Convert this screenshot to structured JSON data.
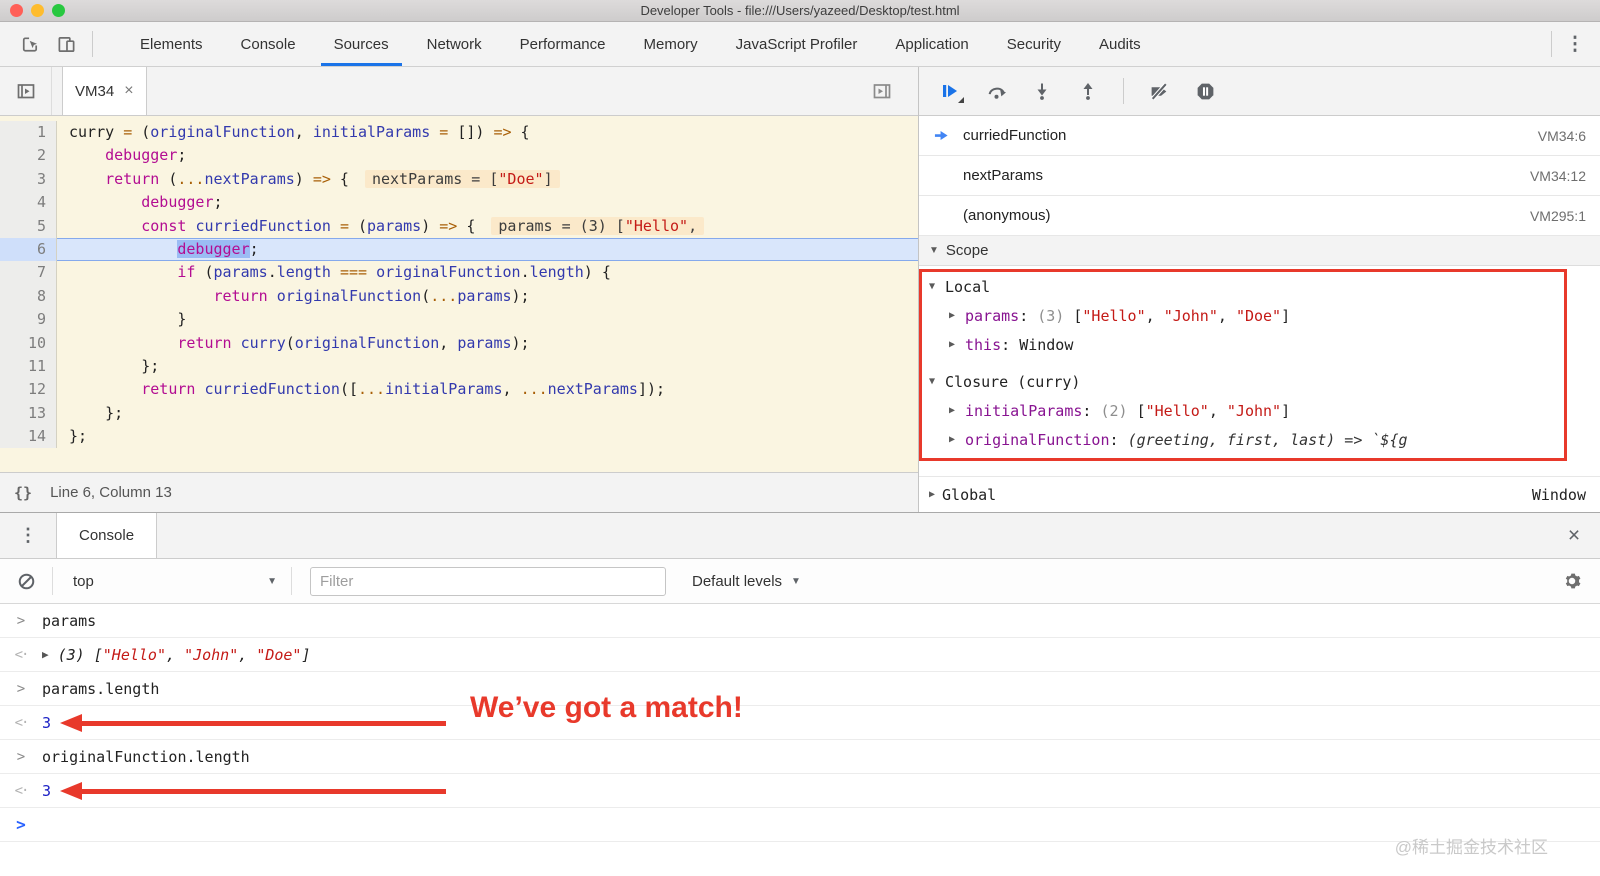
{
  "window": {
    "title": "Developer Tools - file:///Users/yazeed/Desktop/test.html"
  },
  "devtools_tabs": {
    "items": [
      "Elements",
      "Console",
      "Sources",
      "Network",
      "Performance",
      "Memory",
      "JavaScript Profiler",
      "Application",
      "Security",
      "Audits"
    ],
    "selected": "Sources",
    "accent_color": "#1a73e8",
    "overflow_icon": "⋮"
  },
  "sources_panel": {
    "file_tab": {
      "label": "VM34",
      "close_label": "×"
    },
    "status_bar": {
      "pretty_print_label": "{}",
      "position": "Line 6, Column 13"
    },
    "code": {
      "current_line": 6,
      "lines": [
        {
          "n": 1,
          "tokens": [
            [
              "p",
              "curry "
            ],
            [
              "o",
              "="
            ],
            [
              "p",
              " ("
            ],
            [
              "v",
              "originalFunction"
            ],
            [
              "p",
              ", "
            ],
            [
              "v",
              "initialParams"
            ],
            [
              "p",
              " "
            ],
            [
              "o",
              "="
            ],
            [
              "p",
              " []) "
            ],
            [
              "o",
              "=>"
            ],
            [
              "p",
              " {"
            ]
          ]
        },
        {
          "n": 2,
          "tokens": [
            [
              "p",
              "    "
            ],
            [
              "k",
              "debugger"
            ],
            [
              "p",
              ";"
            ]
          ]
        },
        {
          "n": 3,
          "tokens": [
            [
              "p",
              "    "
            ],
            [
              "k",
              "return"
            ],
            [
              "p",
              " ("
            ],
            [
              "o",
              "..."
            ],
            [
              "v",
              "nextParams"
            ],
            [
              "p",
              ") "
            ],
            [
              "o",
              "=>"
            ],
            [
              "p",
              " {"
            ]
          ],
          "annotation": [
            [
              "p",
              "nextParams = ["
            ],
            [
              "s",
              "\"Doe\""
            ],
            [
              "p",
              "]"
            ]
          ]
        },
        {
          "n": 4,
          "tokens": [
            [
              "p",
              "        "
            ],
            [
              "k",
              "debugger"
            ],
            [
              "p",
              ";"
            ]
          ]
        },
        {
          "n": 5,
          "tokens": [
            [
              "p",
              "        "
            ],
            [
              "k",
              "const"
            ],
            [
              "p",
              " "
            ],
            [
              "v",
              "curriedFunction"
            ],
            [
              "p",
              " "
            ],
            [
              "o",
              "="
            ],
            [
              "p",
              " ("
            ],
            [
              "v",
              "params"
            ],
            [
              "p",
              ") "
            ],
            [
              "o",
              "=>"
            ],
            [
              "p",
              " {"
            ]
          ],
          "annotation": [
            [
              "p",
              "params = (3) ["
            ],
            [
              "s",
              "\"Hello\""
            ],
            [
              "p",
              ","
            ]
          ]
        },
        {
          "n": 6,
          "current": true,
          "tokens": [
            [
              "p",
              "            "
            ],
            [
              "kh",
              "debugger"
            ],
            [
              "p",
              ";"
            ]
          ]
        },
        {
          "n": 7,
          "tokens": [
            [
              "p",
              "            "
            ],
            [
              "k",
              "if"
            ],
            [
              "p",
              " ("
            ],
            [
              "v",
              "params"
            ],
            [
              "p",
              "."
            ],
            [
              "v",
              "length"
            ],
            [
              "p",
              " "
            ],
            [
              "o",
              "==="
            ],
            [
              "p",
              " "
            ],
            [
              "v",
              "originalFunction"
            ],
            [
              "p",
              "."
            ],
            [
              "v",
              "length"
            ],
            [
              "p",
              ") {"
            ]
          ]
        },
        {
          "n": 8,
          "tokens": [
            [
              "p",
              "                "
            ],
            [
              "k",
              "return"
            ],
            [
              "p",
              " "
            ],
            [
              "v",
              "originalFunction"
            ],
            [
              "p",
              "("
            ],
            [
              "o",
              "..."
            ],
            [
              "v",
              "params"
            ],
            [
              "p",
              ");"
            ]
          ]
        },
        {
          "n": 9,
          "tokens": [
            [
              "p",
              "            }"
            ]
          ]
        },
        {
          "n": 10,
          "tokens": [
            [
              "p",
              "            "
            ],
            [
              "k",
              "return"
            ],
            [
              "p",
              " "
            ],
            [
              "v",
              "curry"
            ],
            [
              "p",
              "("
            ],
            [
              "v",
              "originalFunction"
            ],
            [
              "p",
              ", "
            ],
            [
              "v",
              "params"
            ],
            [
              "p",
              ");"
            ]
          ]
        },
        {
          "n": 11,
          "tokens": [
            [
              "p",
              "        };"
            ]
          ]
        },
        {
          "n": 12,
          "tokens": [
            [
              "p",
              "        "
            ],
            [
              "k",
              "return"
            ],
            [
              "p",
              " "
            ],
            [
              "v",
              "curriedFunction"
            ],
            [
              "p",
              "(["
            ],
            [
              "o",
              "..."
            ],
            [
              "v",
              "initialParams"
            ],
            [
              "p",
              ", "
            ],
            [
              "o",
              "..."
            ],
            [
              "v",
              "nextParams"
            ],
            [
              "p",
              "]);"
            ]
          ]
        },
        {
          "n": 13,
          "tokens": [
            [
              "p",
              "    };"
            ]
          ]
        },
        {
          "n": 14,
          "tokens": [
            [
              "p",
              "};"
            ]
          ]
        }
      ]
    }
  },
  "debugger_panel": {
    "call_stack": [
      {
        "name": "curriedFunction",
        "location": "VM34:6",
        "active": true
      },
      {
        "name": "nextParams",
        "location": "VM34:12",
        "active": false
      },
      {
        "name": "(anonymous)",
        "location": "VM295:1",
        "active": false
      }
    ],
    "scope": {
      "header": "Scope",
      "rows": [
        {
          "kind": "section",
          "expanded": true,
          "label": "Local"
        },
        {
          "kind": "var",
          "expanded": false,
          "name": "params",
          "preview": [
            [
              "g",
              "(3) "
            ],
            [
              "p",
              "["
            ],
            [
              "s",
              "\"Hello\""
            ],
            [
              "p",
              ", "
            ],
            [
              "s",
              "\"John\""
            ],
            [
              "p",
              ", "
            ],
            [
              "s",
              "\"Doe\""
            ],
            [
              "p",
              "]"
            ]
          ]
        },
        {
          "kind": "var",
          "expanded": false,
          "name": "this",
          "preview": [
            [
              "p",
              "Window"
            ]
          ]
        },
        {
          "kind": "section",
          "expanded": true,
          "label": "Closure (curry)",
          "gap": true
        },
        {
          "kind": "var",
          "expanded": false,
          "name": "initialParams",
          "preview": [
            [
              "g",
              "(2) "
            ],
            [
              "p",
              "["
            ],
            [
              "s",
              "\"Hello\""
            ],
            [
              "p",
              ", "
            ],
            [
              "s",
              "\"John\""
            ],
            [
              "p",
              "]"
            ]
          ]
        },
        {
          "kind": "var",
          "expanded": false,
          "name": "originalFunction",
          "preview": [
            [
              "i",
              "(greeting, first, last) => `${g"
            ]
          ]
        }
      ],
      "global_row": {
        "label": "Global",
        "value": "Window"
      }
    }
  },
  "console_drawer": {
    "menu_icon": "⋮",
    "tab_label": "Console",
    "close_label": "×",
    "toolbar": {
      "context": "top",
      "dropdown_icon": "▼",
      "filter_placeholder": "Filter",
      "levels_label": "Default levels"
    },
    "entries": [
      {
        "kind": "input",
        "text": "params"
      },
      {
        "kind": "result",
        "expandable": true,
        "italic": true,
        "tokens": [
          [
            "p",
            "(3) ["
          ],
          [
            "s",
            "\"Hello\""
          ],
          [
            "p",
            ", "
          ],
          [
            "s",
            "\"John\""
          ],
          [
            "p",
            ", "
          ],
          [
            "s",
            "\"Doe\""
          ],
          [
            "p",
            "]"
          ]
        ]
      },
      {
        "kind": "input",
        "text": "params.length"
      },
      {
        "kind": "result",
        "tokens": [
          [
            "n",
            "3"
          ]
        ],
        "arrow": true
      },
      {
        "kind": "input",
        "text": "originalFunction.length"
      },
      {
        "kind": "result",
        "tokens": [
          [
            "n",
            "3"
          ]
        ],
        "arrow": true
      },
      {
        "kind": "prompt"
      }
    ]
  },
  "annotations": {
    "match_text": "We’ve got a match!",
    "color": "#e8392b"
  },
  "watermark": "@稀土掘金技术社区"
}
